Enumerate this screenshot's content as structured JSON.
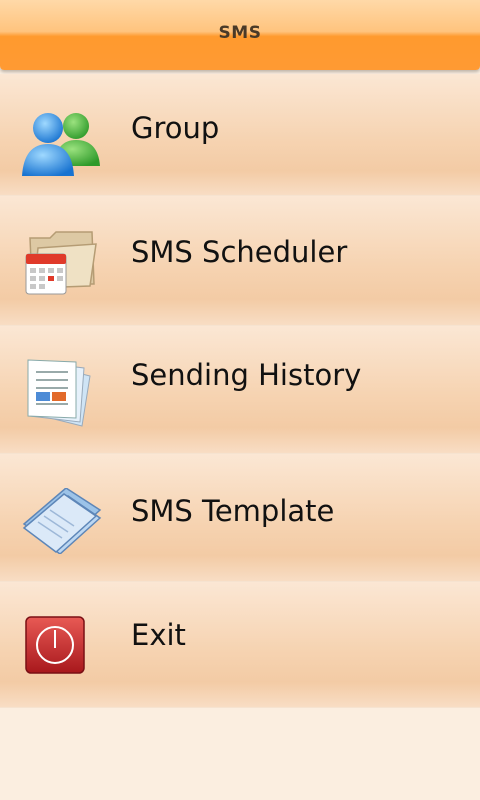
{
  "header": {
    "title": "SMS"
  },
  "menu": {
    "items": [
      {
        "label": "Group",
        "icon": "group-icon"
      },
      {
        "label": "SMS Scheduler",
        "icon": "calendar-folder-icon"
      },
      {
        "label": "Sending History",
        "icon": "documents-icon"
      },
      {
        "label": "SMS Template",
        "icon": "template-icon"
      },
      {
        "label": "Exit",
        "icon": "power-icon"
      }
    ]
  },
  "colors": {
    "header_accent": "#ff9a2e",
    "exit_red": "#c8242a"
  }
}
